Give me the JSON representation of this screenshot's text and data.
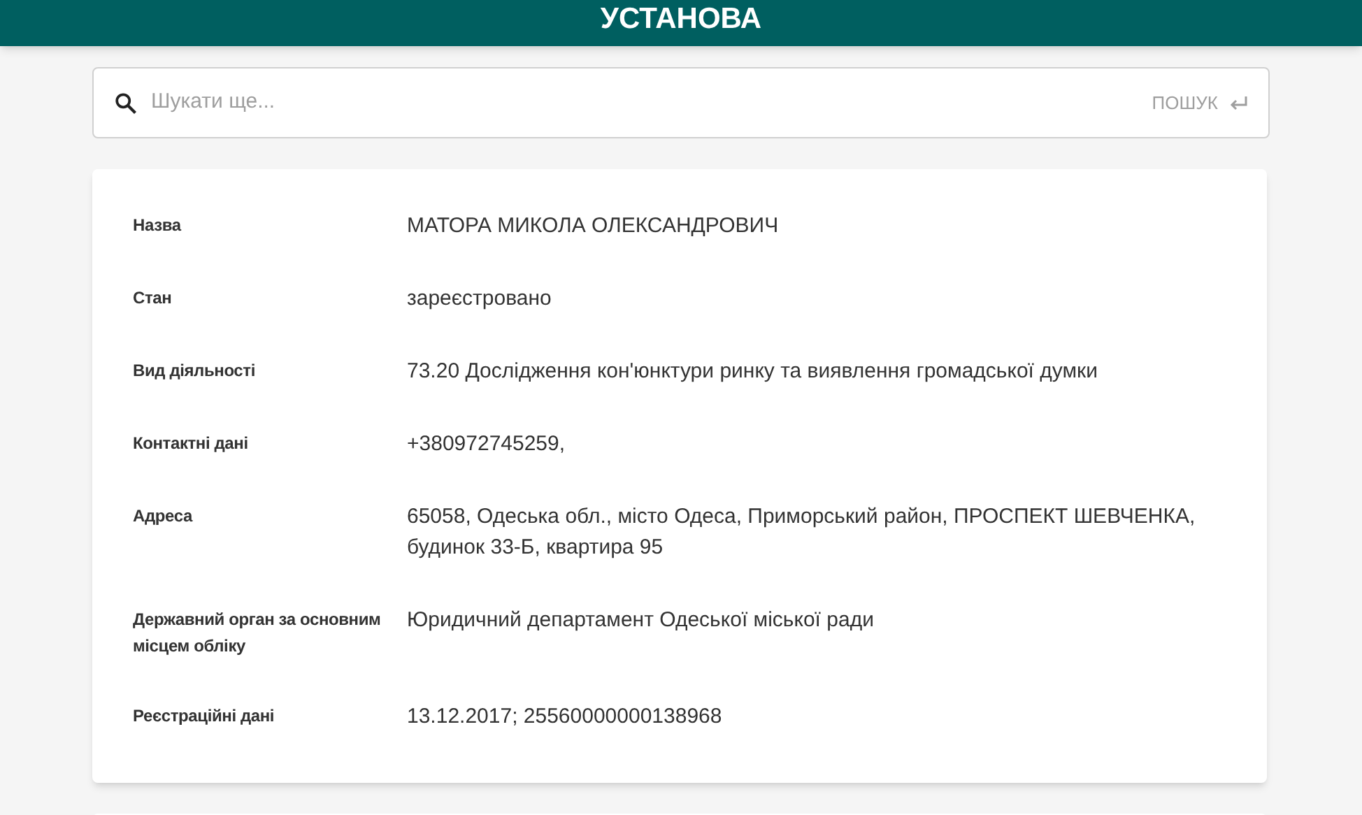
{
  "header": {
    "title": "УСТАНОВА"
  },
  "search": {
    "placeholder": "Шукати ще...",
    "button": "ПОШУК"
  },
  "details": [
    {
      "label": "Назва",
      "value": "МАТОРА МИКОЛА ОЛЕКСАНДРОВИЧ"
    },
    {
      "label": "Стан",
      "value": "зареєстровано"
    },
    {
      "label": "Вид діяльності",
      "value": "73.20 Дослідження кон'юнктури ринку та виявлення громадської думки"
    },
    {
      "label": "Контактні дані",
      "value": "+380972745259,"
    },
    {
      "label": "Адреса",
      "value": "65058, Одеська обл., місто Одеса, Приморський район, ПРОСПЕКТ ШЕВЧЕНКА, будинок 33-Б, квартира 95"
    },
    {
      "label": "Державний орган за основним місцем обліку",
      "value": "Юридичний департамент Одеської міської ради"
    },
    {
      "label": "Реєстраційні дані",
      "value": "13.12.2017; 25560000000138968"
    }
  ]
}
